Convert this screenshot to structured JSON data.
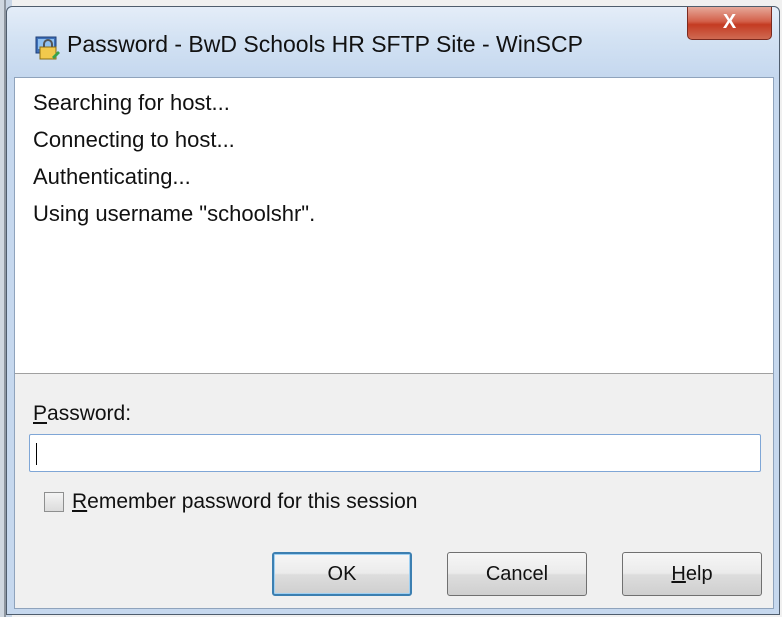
{
  "window": {
    "title": "Password - BwD Schools HR SFTP Site - WinSCP",
    "close_glyph": "X"
  },
  "log": {
    "lines": [
      "Searching for host...",
      "Connecting to host...",
      "Authenticating...",
      "Using username \"schoolshr\"."
    ]
  },
  "password": {
    "label_mnemonic": "P",
    "label_rest": "assword:",
    "value": ""
  },
  "remember": {
    "mnemonic": "R",
    "rest": "emember password for this session",
    "checked": false
  },
  "buttons": {
    "ok": "OK",
    "cancel": "Cancel",
    "help_mnemonic": "H",
    "help_rest": "elp"
  },
  "icons": {
    "app": "winscp-icon",
    "close": "close-icon"
  },
  "colors": {
    "titlebar": "#c6d8ee",
    "close_button": "#c43b22",
    "default_button_border": "#3c7fb1"
  }
}
